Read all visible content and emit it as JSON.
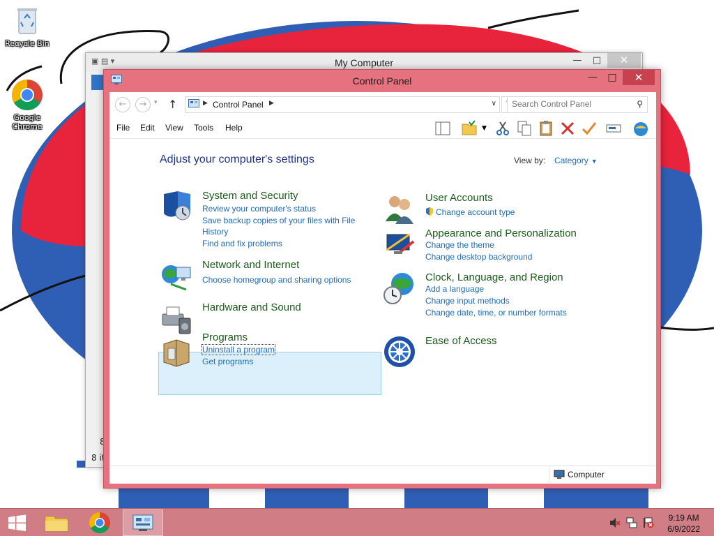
{
  "desktop": {
    "icons": [
      {
        "label": "Recycle Bin",
        "icon": "recycle-bin-icon"
      },
      {
        "label": "Google Chrome",
        "icon": "chrome-icon"
      }
    ]
  },
  "background_window": {
    "title": "My Computer",
    "status_count": "8 it",
    "status_partial": "8"
  },
  "window": {
    "title": "Control Panel",
    "controls": {
      "minimize": "—",
      "maximize": "□",
      "close": "✕"
    }
  },
  "address": {
    "breadcrumb": "Control Panel",
    "search_placeholder": "Search Control Panel"
  },
  "menu": [
    "File",
    "Edit",
    "View",
    "Tools",
    "Help"
  ],
  "content": {
    "heading": "Adjust your computer's settings",
    "view_by_label": "View by:",
    "view_by_value": "Category",
    "categories": [
      {
        "title": "System and Security",
        "links": [
          "Review your computer's status",
          "Save backup copies of your files with File",
          "History",
          "Find and fix problems"
        ]
      },
      {
        "title": "Network and Internet",
        "links": [
          "Choose homegroup and sharing options"
        ]
      },
      {
        "title": "Hardware and Sound",
        "links": []
      },
      {
        "title": "Programs",
        "links": [
          "Uninstall a program",
          "Get programs"
        ]
      },
      {
        "title": "User Accounts",
        "links": [
          "Change account type"
        ]
      },
      {
        "title": "Appearance and Personalization",
        "links": [
          "Change the theme",
          "Change desktop background"
        ]
      },
      {
        "title": "Clock, Language, and Region",
        "links": [
          "Add a language",
          "Change input methods",
          "Change date, time, or number formats"
        ]
      },
      {
        "title": "Ease of Access",
        "links": []
      }
    ]
  },
  "statusbar": {
    "location": "Computer"
  },
  "taskbar": {
    "items": [
      "start-button",
      "file-explorer",
      "chrome",
      "control-panel"
    ],
    "clock_time": "9:19 AM",
    "clock_date": "6/9/2022"
  },
  "colors": {
    "window_frame": "#e6727f",
    "taskbar": "#d17d86",
    "link": "#1e6bb8",
    "category_title": "#1c5a1c",
    "heading": "#1e3287"
  }
}
